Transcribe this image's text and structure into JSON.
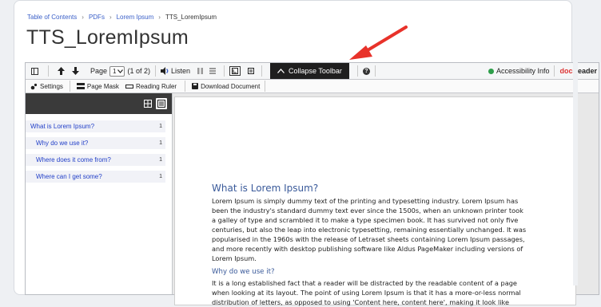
{
  "breadcrumb": {
    "items": [
      "Table of Contents",
      "PDFs",
      "Lorem Ipsum"
    ],
    "current": "TTS_LoremIpsum",
    "separator": "›"
  },
  "page_title": "TTS_LoremIpsum",
  "toolbar": {
    "page_label": "Page",
    "page_value": "1",
    "page_of": "(1 of 2)",
    "listen_label": "Listen",
    "collapse_label": "Collapse Toolbar",
    "accessibility_label": "Accessibility Info",
    "brand_doc": "doc",
    "brand_reader": "Reader",
    "settings_label": "Settings",
    "page_mask_label": "Page Mask",
    "reading_ruler_label": "Reading Ruler",
    "download_label": "Download Document"
  },
  "toc": {
    "items": [
      {
        "label": "What is Lorem Ipsum?",
        "page": "1",
        "indent": 0
      },
      {
        "label": "Why do we use it?",
        "page": "1",
        "indent": 1
      },
      {
        "label": "Where does it come from?",
        "page": "1",
        "indent": 1
      },
      {
        "label": "Where can I get some?",
        "page": "1",
        "indent": 1
      }
    ]
  },
  "document": {
    "heading1": "What is Lorem Ipsum?",
    "para1": [
      "Lorem Ipsum is simply dummy text of the printing and typesetting industry. Lorem Ipsum has",
      "been the industry's standard dummy text ever since the 1500s, when an unknown printer took",
      "a galley of type and scrambled it to make a type specimen book. It has survived not only five",
      "centuries, but also the leap into electronic typesetting, remaining essentially unchanged. It was",
      "popularised in the 1960s with the release of Letraset sheets containing Lorem Ipsum passages,",
      "and more recently with desktop publishing software like Aldus PageMaker including versions of",
      "Lorem Ipsum."
    ],
    "heading2": "Why do we use it?",
    "para2": [
      "It is a long established fact that a reader will be distracted by the readable content of a page",
      "when looking at its layout. The point of using Lorem Ipsum is that it has a more-or-less normal",
      "distribution of letters, as opposed to using 'Content here, content here', making it look like"
    ]
  },
  "colors": {
    "link": "#3a5fc8",
    "annotation_arrow": "#e8322a",
    "collapse_bg": "#1f1f1f",
    "accessibility_ok": "#2e9e4a"
  }
}
